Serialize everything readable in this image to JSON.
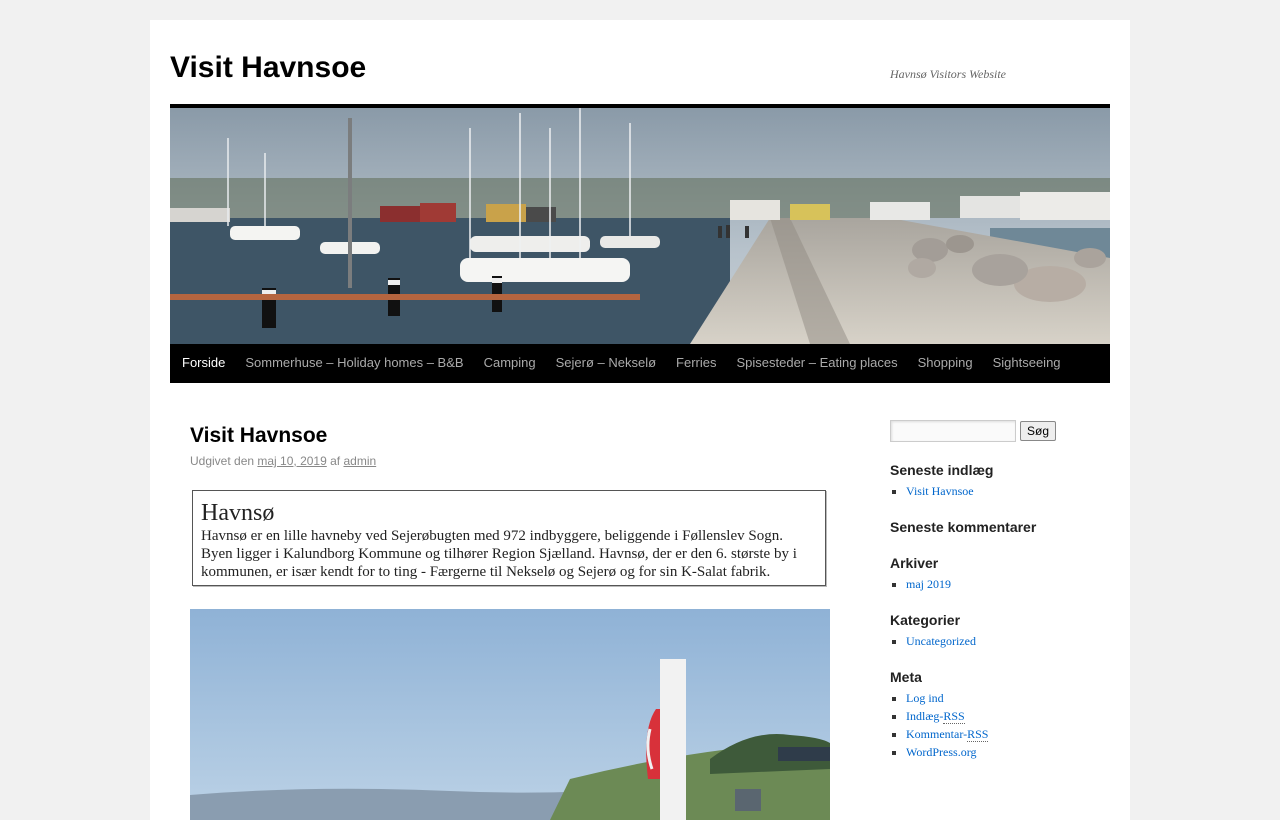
{
  "site": {
    "title": "Visit Havnsoe",
    "description": "Havnsø Visitors Website"
  },
  "nav": {
    "items": [
      {
        "label": "Forside"
      },
      {
        "label": "Sommerhuse – Holiday homes – B&B"
      },
      {
        "label": "Camping"
      },
      {
        "label": "Sejerø – Nekselø"
      },
      {
        "label": "Ferries"
      },
      {
        "label": "Spisesteder – Eating places"
      },
      {
        "label": "Shopping"
      },
      {
        "label": "Sightseeing"
      }
    ]
  },
  "post": {
    "title": "Visit Havnsoe",
    "meta_prefix": "Udgivet den",
    "date": "maj 10, 2019",
    "meta_by": "af",
    "author": "admin",
    "infobox": {
      "heading": "Havnsø",
      "text": "Havnsø er en lille havneby ved Sejerøbugten med 972 indbyggere, beliggende i Føllenslev Sogn. Byen ligger i Kalundborg Kommune og tilhører Region Sjælland. Havnsø, der er den 6. største by i kommunen, er især kendt for to ting  -  Færgerne til Nekselø og Sejerø og for sin K-Salat fabrik."
    }
  },
  "sidebar": {
    "search_button": "Søg",
    "recent_posts": {
      "title": "Seneste indlæg",
      "items": [
        "Visit Havnsoe"
      ]
    },
    "recent_comments": {
      "title": "Seneste kommentarer"
    },
    "archives": {
      "title": "Arkiver",
      "items": [
        "maj 2019"
      ]
    },
    "categories": {
      "title": "Kategorier",
      "items": [
        "Uncategorized"
      ]
    },
    "meta": {
      "title": "Meta",
      "login": "Log ind",
      "entries_prefix": "Indlæg-",
      "comments_prefix": "Kommentar-",
      "rss": "RSS",
      "wordpress": "WordPress.org"
    }
  },
  "colors": {
    "nav_bg": "#000000",
    "link": "#0066cc",
    "page_bg": "#f1f1f1"
  }
}
